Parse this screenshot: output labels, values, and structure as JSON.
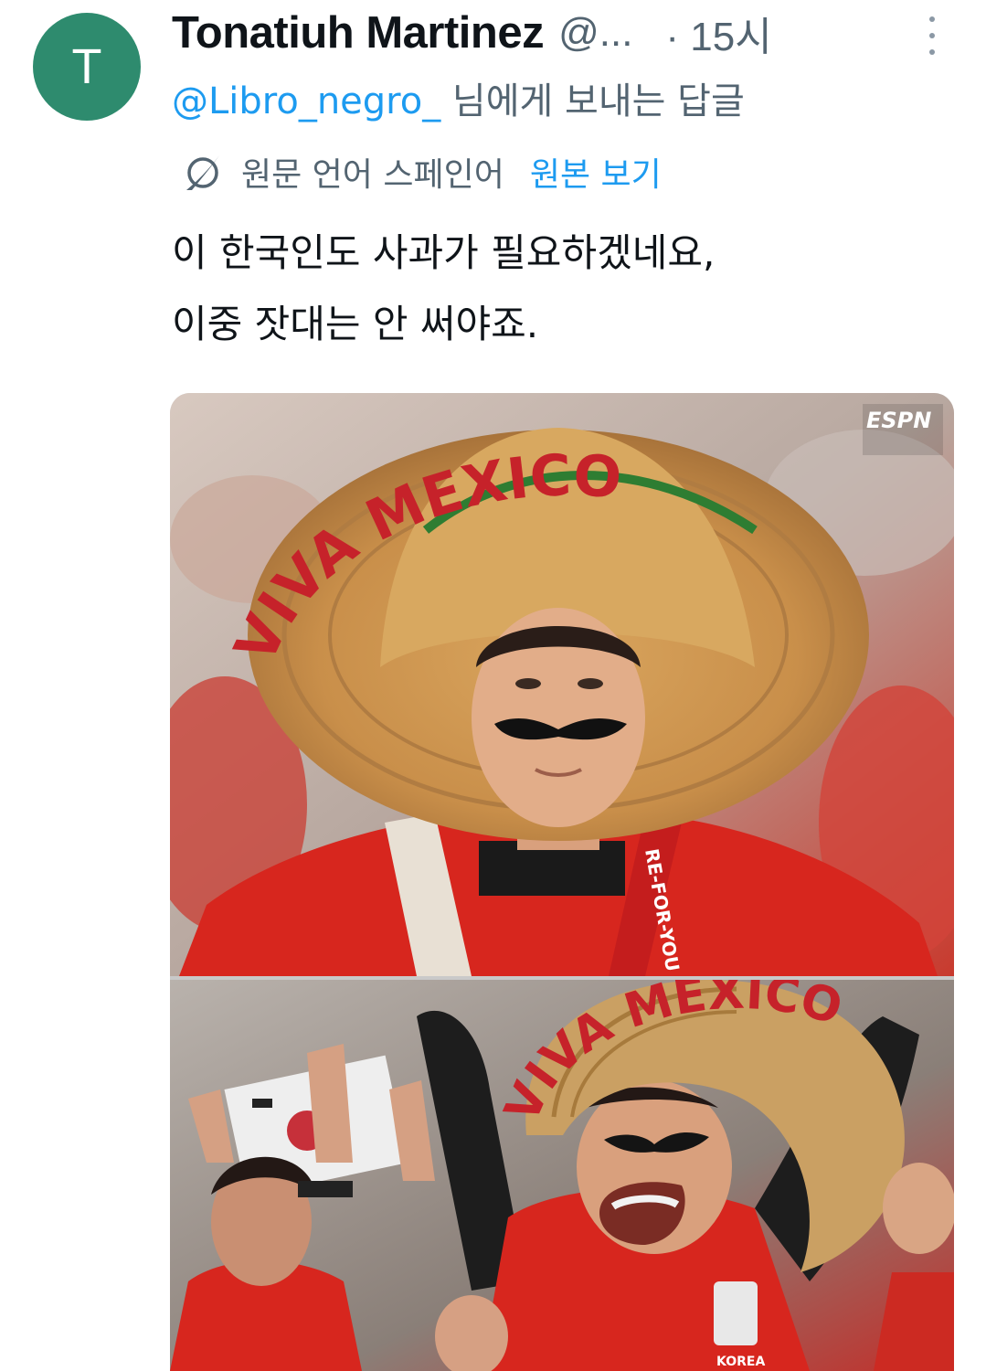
{
  "author": {
    "avatar_initial": "T",
    "avatar_color": "#2e8b6e",
    "name": "Tonatiuh Martinez",
    "handle": "@...",
    "time": "· 15시"
  },
  "reply": {
    "mention": "@Libro_negro_",
    "suffix": " 님에게 보내는 답글"
  },
  "translation": {
    "icon": "translate-icon",
    "label": "원문 언어 스페인어",
    "show_original": "원본 보기"
  },
  "tweet": {
    "lines": [
      "이 한국인도 사과가 필요하겠네요,",
      "이중 잣대는 안 써야죠."
    ]
  },
  "media": {
    "image1": {
      "hat_text": "VIVA MEXICO",
      "broadcast_logo": "ESPN",
      "scarf_text": "RE-FOR-YOU"
    },
    "image2": {
      "hat_text": "VIVA MEXICO",
      "jersey_text": "KOREA"
    }
  },
  "colors": {
    "link": "#1d9bf0",
    "secondary_text": "#536471",
    "primary_text": "#0f1419"
  }
}
